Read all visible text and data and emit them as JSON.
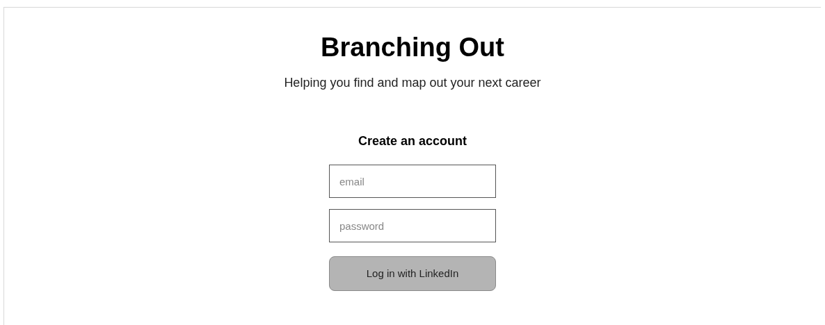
{
  "header": {
    "title": "Branching Out",
    "tagline": "Helping you find and map out your next career"
  },
  "form": {
    "heading": "Create an account",
    "fields": [
      {
        "placeholder": "email"
      },
      {
        "placeholder": "password"
      }
    ],
    "button": "Log in with LinkedIn"
  }
}
